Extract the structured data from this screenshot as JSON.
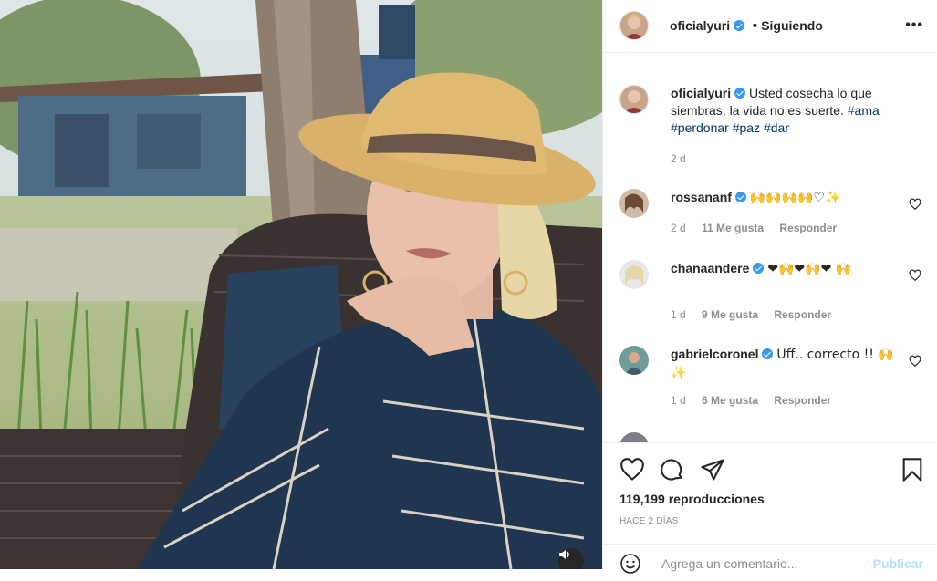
{
  "header": {
    "username": "oficialyuri",
    "follow_status": "Siguiendo",
    "more_icon": "more-dots-icon"
  },
  "caption": {
    "username": "oficialyuri",
    "text": "Usted cosecha lo que siembras, la vida no es suerte.",
    "hashtags": [
      "#ama",
      "#perdonar",
      "#paz",
      "#dar"
    ],
    "time": "2 d"
  },
  "comments": [
    {
      "username": "rossananf",
      "text": "🙌🙌🙌🙌♡✨",
      "time": "2 d",
      "likes": "11 Me gusta",
      "reply": "Responder"
    },
    {
      "username": "chanaandere",
      "text": "❤🙌❤🙌❤ 🙌",
      "time": "1 d",
      "likes": "9 Me gusta",
      "reply": "Responder"
    },
    {
      "username": "gabrielcoronel",
      "text": "Uff.. correcto !! 🙌✨",
      "time": "1 d",
      "likes": "6 Me gusta",
      "reply": "Responder"
    }
  ],
  "stats": {
    "views": "119,199 reproducciones",
    "age": "HACE 2 DÍAS"
  },
  "add_comment": {
    "placeholder": "Agrega un comentario...",
    "publish": "Publicar"
  },
  "colors": {
    "link": "#00376b",
    "verified": "#3897f0",
    "muted": "#8e8e8e",
    "publish_disabled": "#b2dffc"
  }
}
